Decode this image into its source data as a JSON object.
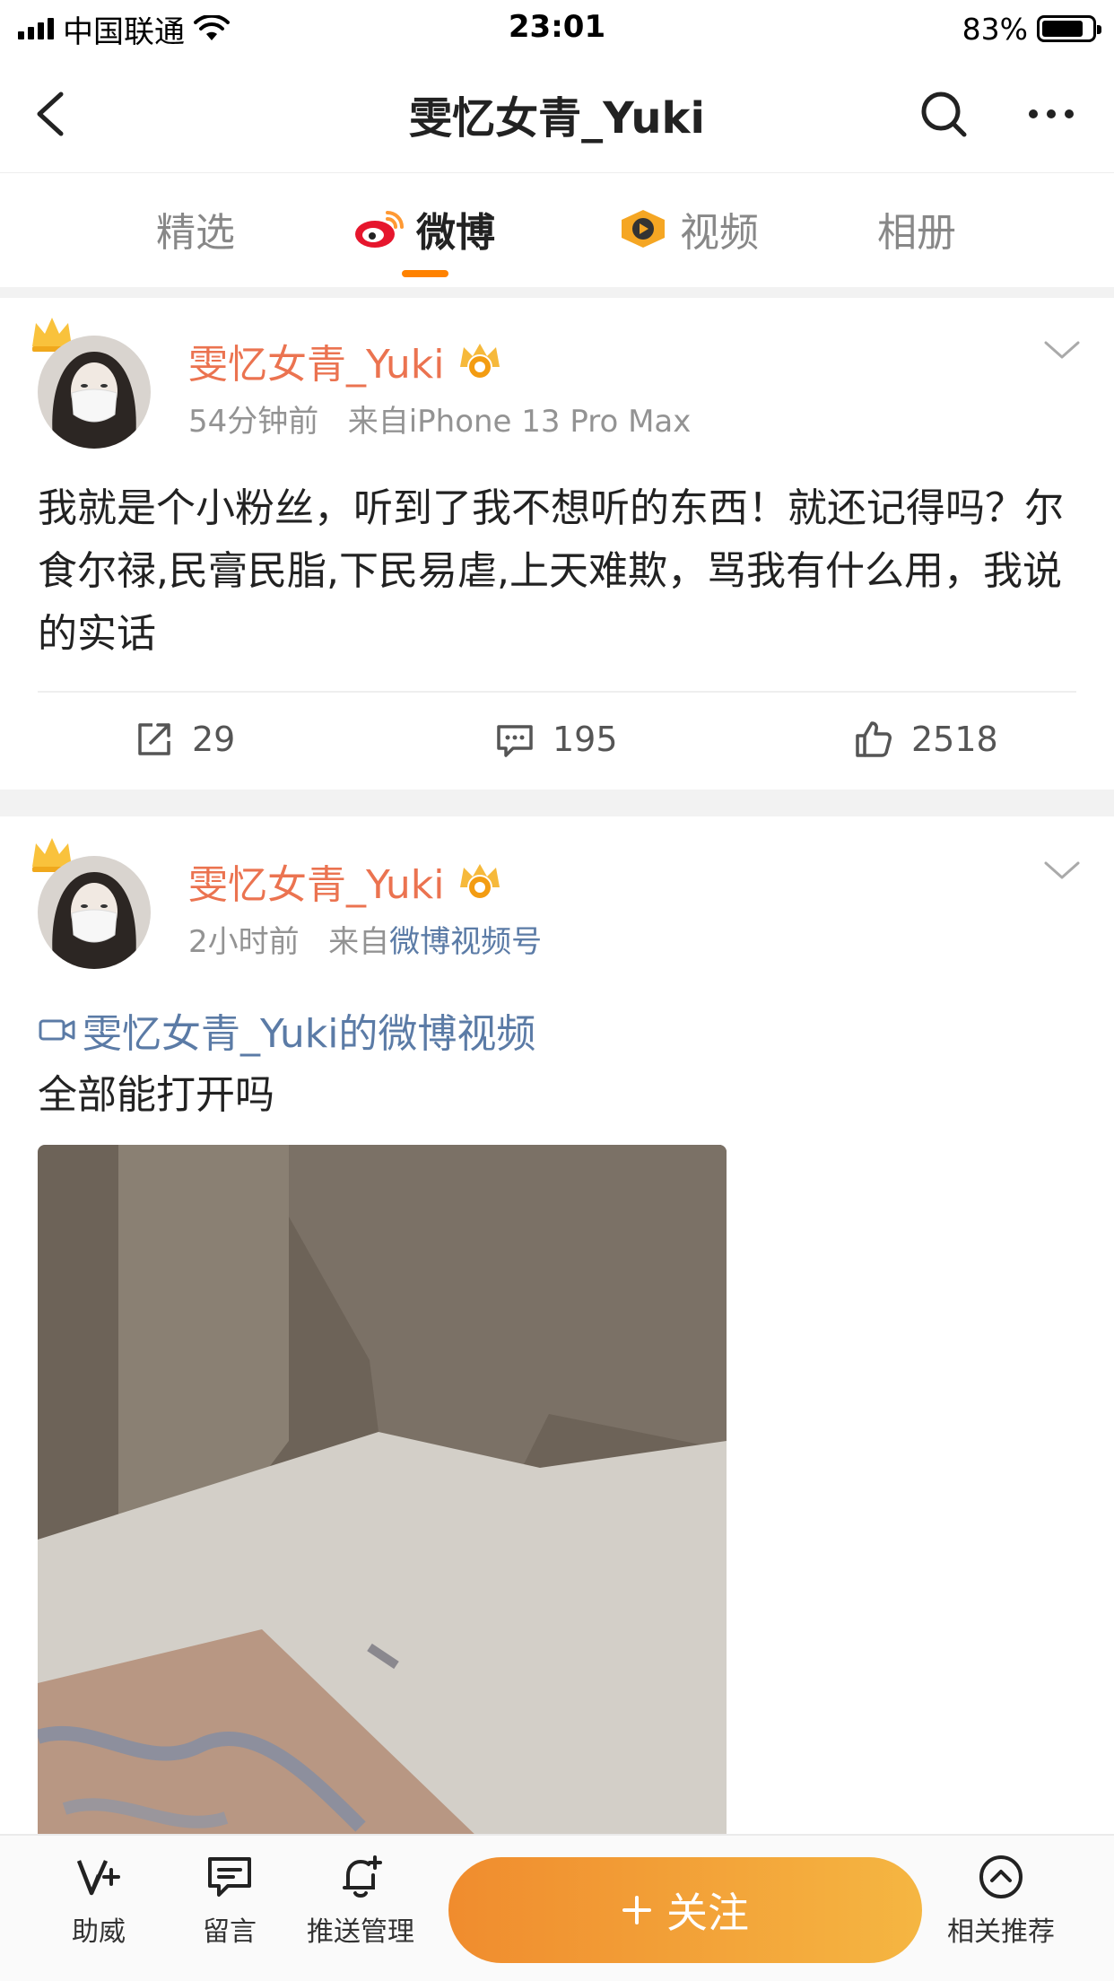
{
  "status_bar": {
    "carrier": "中国联通",
    "time": "23:01",
    "battery": "83%",
    "battery_level": 0.83
  },
  "nav": {
    "title": "雯忆女青_Yuki",
    "back_icon": "back-chevron-icon",
    "search_icon": "search-icon",
    "more_icon": "more-icon"
  },
  "tabs": [
    {
      "label": "精选",
      "active": false
    },
    {
      "label": "微博",
      "active": true,
      "icon": "weibo-logo-icon"
    },
    {
      "label": "视频",
      "active": false,
      "icon": "video-badge-icon"
    },
    {
      "label": "相册",
      "active": false
    }
  ],
  "accent": "#ff8200",
  "posts": [
    {
      "author": "雯忆女青_Yuki",
      "time": "54分钟前",
      "source_prefix": "来自",
      "source": "iPhone 13 Pro Max",
      "text": "我就是个小粉丝，听到了我不想听的东西！就还记得吗？尔食尔禄,民膏民脂,下民易虐,上天难欺，骂我有什么用，我说的实话",
      "reposts": "29",
      "comments": "195",
      "likes": "2518"
    },
    {
      "author": "雯忆女青_Yuki",
      "time": "2小时前",
      "source_prefix": "来自",
      "source": "微博视频号",
      "video_link": "雯忆女青_Yuki的微博视频",
      "text": "全部能打开吗"
    }
  ],
  "bottom_bar": {
    "items": [
      {
        "label": "助威",
        "icon": "cheer-v-icon"
      },
      {
        "label": "留言",
        "icon": "message-icon"
      },
      {
        "label": "推送管理",
        "icon": "bell-plus-icon"
      },
      {
        "label": "相关推荐",
        "icon": "chevron-up-circle-icon"
      }
    ],
    "follow_label": "关注",
    "follow_icon": "plus-icon"
  }
}
